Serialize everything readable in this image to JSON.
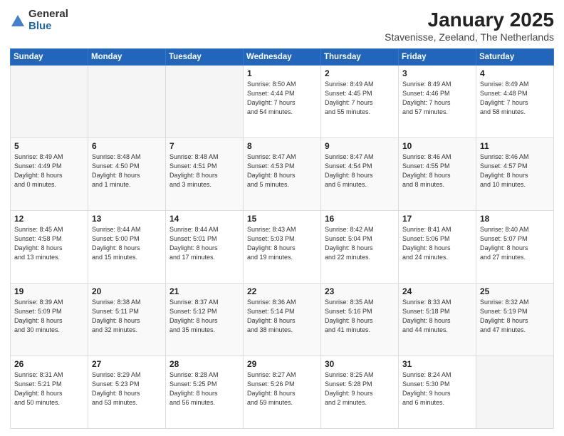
{
  "logo": {
    "general": "General",
    "blue": "Blue"
  },
  "header": {
    "month": "January 2025",
    "location": "Stavenisse, Zeeland, The Netherlands"
  },
  "weekdays": [
    "Sunday",
    "Monday",
    "Tuesday",
    "Wednesday",
    "Thursday",
    "Friday",
    "Saturday"
  ],
  "weeks": [
    [
      {
        "day": "",
        "text": ""
      },
      {
        "day": "",
        "text": ""
      },
      {
        "day": "",
        "text": ""
      },
      {
        "day": "1",
        "text": "Sunrise: 8:50 AM\nSunset: 4:44 PM\nDaylight: 7 hours\nand 54 minutes."
      },
      {
        "day": "2",
        "text": "Sunrise: 8:49 AM\nSunset: 4:45 PM\nDaylight: 7 hours\nand 55 minutes."
      },
      {
        "day": "3",
        "text": "Sunrise: 8:49 AM\nSunset: 4:46 PM\nDaylight: 7 hours\nand 57 minutes."
      },
      {
        "day": "4",
        "text": "Sunrise: 8:49 AM\nSunset: 4:48 PM\nDaylight: 7 hours\nand 58 minutes."
      }
    ],
    [
      {
        "day": "5",
        "text": "Sunrise: 8:49 AM\nSunset: 4:49 PM\nDaylight: 8 hours\nand 0 minutes."
      },
      {
        "day": "6",
        "text": "Sunrise: 8:48 AM\nSunset: 4:50 PM\nDaylight: 8 hours\nand 1 minute."
      },
      {
        "day": "7",
        "text": "Sunrise: 8:48 AM\nSunset: 4:51 PM\nDaylight: 8 hours\nand 3 minutes."
      },
      {
        "day": "8",
        "text": "Sunrise: 8:47 AM\nSunset: 4:53 PM\nDaylight: 8 hours\nand 5 minutes."
      },
      {
        "day": "9",
        "text": "Sunrise: 8:47 AM\nSunset: 4:54 PM\nDaylight: 8 hours\nand 6 minutes."
      },
      {
        "day": "10",
        "text": "Sunrise: 8:46 AM\nSunset: 4:55 PM\nDaylight: 8 hours\nand 8 minutes."
      },
      {
        "day": "11",
        "text": "Sunrise: 8:46 AM\nSunset: 4:57 PM\nDaylight: 8 hours\nand 10 minutes."
      }
    ],
    [
      {
        "day": "12",
        "text": "Sunrise: 8:45 AM\nSunset: 4:58 PM\nDaylight: 8 hours\nand 13 minutes."
      },
      {
        "day": "13",
        "text": "Sunrise: 8:44 AM\nSunset: 5:00 PM\nDaylight: 8 hours\nand 15 minutes."
      },
      {
        "day": "14",
        "text": "Sunrise: 8:44 AM\nSunset: 5:01 PM\nDaylight: 8 hours\nand 17 minutes."
      },
      {
        "day": "15",
        "text": "Sunrise: 8:43 AM\nSunset: 5:03 PM\nDaylight: 8 hours\nand 19 minutes."
      },
      {
        "day": "16",
        "text": "Sunrise: 8:42 AM\nSunset: 5:04 PM\nDaylight: 8 hours\nand 22 minutes."
      },
      {
        "day": "17",
        "text": "Sunrise: 8:41 AM\nSunset: 5:06 PM\nDaylight: 8 hours\nand 24 minutes."
      },
      {
        "day": "18",
        "text": "Sunrise: 8:40 AM\nSunset: 5:07 PM\nDaylight: 8 hours\nand 27 minutes."
      }
    ],
    [
      {
        "day": "19",
        "text": "Sunrise: 8:39 AM\nSunset: 5:09 PM\nDaylight: 8 hours\nand 30 minutes."
      },
      {
        "day": "20",
        "text": "Sunrise: 8:38 AM\nSunset: 5:11 PM\nDaylight: 8 hours\nand 32 minutes."
      },
      {
        "day": "21",
        "text": "Sunrise: 8:37 AM\nSunset: 5:12 PM\nDaylight: 8 hours\nand 35 minutes."
      },
      {
        "day": "22",
        "text": "Sunrise: 8:36 AM\nSunset: 5:14 PM\nDaylight: 8 hours\nand 38 minutes."
      },
      {
        "day": "23",
        "text": "Sunrise: 8:35 AM\nSunset: 5:16 PM\nDaylight: 8 hours\nand 41 minutes."
      },
      {
        "day": "24",
        "text": "Sunrise: 8:33 AM\nSunset: 5:18 PM\nDaylight: 8 hours\nand 44 minutes."
      },
      {
        "day": "25",
        "text": "Sunrise: 8:32 AM\nSunset: 5:19 PM\nDaylight: 8 hours\nand 47 minutes."
      }
    ],
    [
      {
        "day": "26",
        "text": "Sunrise: 8:31 AM\nSunset: 5:21 PM\nDaylight: 8 hours\nand 50 minutes."
      },
      {
        "day": "27",
        "text": "Sunrise: 8:29 AM\nSunset: 5:23 PM\nDaylight: 8 hours\nand 53 minutes."
      },
      {
        "day": "28",
        "text": "Sunrise: 8:28 AM\nSunset: 5:25 PM\nDaylight: 8 hours\nand 56 minutes."
      },
      {
        "day": "29",
        "text": "Sunrise: 8:27 AM\nSunset: 5:26 PM\nDaylight: 8 hours\nand 59 minutes."
      },
      {
        "day": "30",
        "text": "Sunrise: 8:25 AM\nSunset: 5:28 PM\nDaylight: 9 hours\nand 2 minutes."
      },
      {
        "day": "31",
        "text": "Sunrise: 8:24 AM\nSunset: 5:30 PM\nDaylight: 9 hours\nand 6 minutes."
      },
      {
        "day": "",
        "text": ""
      }
    ]
  ]
}
